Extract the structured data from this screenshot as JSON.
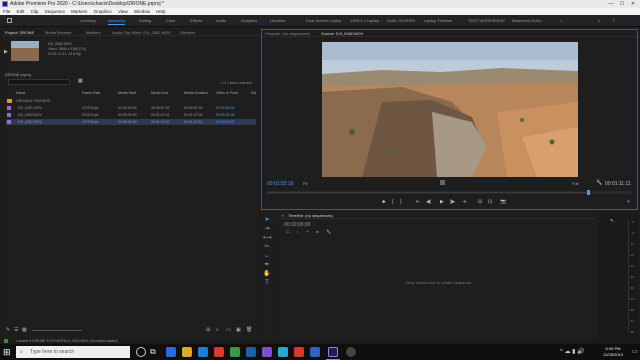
{
  "titlebar": {
    "title": "Adobe Premiere Pro 2020 - C:\\Users\\chavis\\Desktop\\DRONE.prproj *",
    "min": "—",
    "max": "☐",
    "close": "✕"
  },
  "menu": [
    "File",
    "Edit",
    "Clip",
    "Sequence",
    "Markers",
    "Graphics",
    "View",
    "Window",
    "Help"
  ],
  "workspaces": [
    {
      "label": "Learning",
      "active": false
    },
    {
      "label": "Assembly",
      "active": true
    },
    {
      "label": "Editing",
      "active": false
    },
    {
      "label": "Color",
      "active": false
    },
    {
      "label": "Effects",
      "active": false
    },
    {
      "label": "Audio",
      "active": false
    },
    {
      "label": "Graphics",
      "active": false
    },
    {
      "label": "Libraries",
      "active": false
    },
    {
      "label": "Dual Screen Laptop",
      "active": false
    },
    {
      "label": "VIDEO 4 Laptop",
      "active": false
    },
    {
      "label": "DUAL SCREEN",
      "active": false
    },
    {
      "label": "Laptop Timeline",
      "active": false
    },
    {
      "label": "TEST WORKSPACE",
      "active": false
    },
    {
      "label": "Basement DUAL",
      "active": false
    }
  ],
  "project": {
    "tabs": [
      "Project: DRONE",
      "Media Browser",
      "Markers",
      "Audio Clip Mixer: DJI_0062.MOV",
      "Libraries"
    ],
    "clip_name": "DJI_0062.MOV",
    "clip_info1": "Video, 3840 x 2160 (1.0)",
    "clip_info2": "00:01:12:11, 23.976p",
    "bin_name": "DRONE.prproj",
    "items_selected": "1 of 4 items selected",
    "columns": [
      "Name",
      "Frame Rate",
      "Media Start",
      "Media End",
      "Media Duration",
      "Video In Point",
      "Vid"
    ],
    "rows": [
      {
        "name": "ORIGINAL FOOTAGE",
        "rate": "",
        "start": "",
        "end": "",
        "dur": "",
        "in": "",
        "selected": false,
        "folder": true
      },
      {
        "name": "DJI_0061.MOV",
        "rate": "23.976 fps",
        "start": "00:00:00:00",
        "end": "00:00:57:02",
        "dur": "00:00:57:03",
        "in": "00:00:00:00",
        "selected": false,
        "folder": false
      },
      {
        "name": "DJI_0063.MOV",
        "rate": "23.976 fps",
        "start": "00:00:00:00",
        "end": "00:01:47:02",
        "dur": "00:01:47:03",
        "in": "00:00:00:00",
        "selected": false,
        "folder": false
      },
      {
        "name": "DJI_0062.MOV",
        "rate": "23.976 fps",
        "start": "00:00:00:00",
        "end": "00:01:12:10",
        "dur": "00:01:12:11",
        "in": "00:00:00:00",
        "selected": true,
        "folder": false
      }
    ]
  },
  "monitor": {
    "tabs": [
      "Program: (no sequences)",
      "Source: DJI_0062.MOV"
    ],
    "timecode": "00:01:02:16",
    "fit": "Fit",
    "full": "Full",
    "duration": "00:01:11:11"
  },
  "timeline": {
    "title": "Timeline: (no sequences)",
    "timecode": "00;00;00;00",
    "empty_msg": "Drop media here to create sequence."
  },
  "meter_ticks": [
    "0",
    "-6",
    "-12",
    "-18",
    "-24",
    "-30",
    "-36",
    "-42",
    "-48",
    "-54",
    "dB"
  ],
  "status": "Loaded H:\\DRONE FOOTAGE\\DJI_0062.MOV (43 media loaded)",
  "taskbar": {
    "search_placeholder": "Type here to search",
    "time": "5:06 PM",
    "date": "12/28/2019"
  },
  "colors": {
    "accent": "#4a9cf0",
    "selection": "#2d3a54"
  }
}
